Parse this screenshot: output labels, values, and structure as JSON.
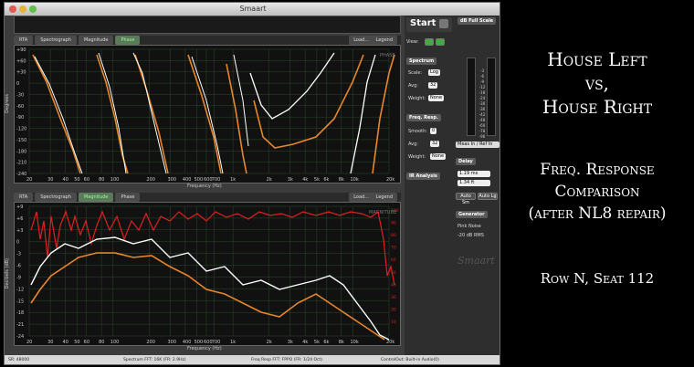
{
  "window": {
    "title": "Smaart",
    "status": {
      "sample_rate": "SR: 48000",
      "spectrum_fft": "Spectrum FFT: 16K (FR: 2.9Hz)",
      "freq_resp_fft": "Freq Resp FFT: FPPO (FR: 1/24 Oct)",
      "control": "ControlOut: Built-in Audio(0)"
    }
  },
  "top_plot": {
    "tabs": [
      "RTA",
      "Spectrograph",
      "Magnitude",
      "Phase"
    ],
    "active_tab": "Phase",
    "load_label": "Load...",
    "legend_label": "Legend",
    "overlay_label": "PHASE",
    "y_axis_label": "Degrees",
    "x_axis_label": "Frequency (Hz)",
    "y_ticks": [
      "+90",
      "+60",
      "+30",
      "0",
      "-30",
      "-60",
      "-90",
      "-120",
      "-150",
      "-180",
      "-210",
      "-240"
    ],
    "x_ticks": [
      "20",
      "30",
      "40",
      "50",
      "60",
      "80",
      "100",
      "200",
      "300",
      "400",
      "500",
      "600",
      "700",
      "1k",
      "2k",
      "3k",
      "4k",
      "5k",
      "6k",
      "8k",
      "10k",
      "20k"
    ]
  },
  "bottom_plot": {
    "tabs": [
      "RTA",
      "Spectrograph",
      "Magnitude",
      "Phase"
    ],
    "active_tab": "Magnitude",
    "load_label": "Load...",
    "legend_label": "Legend",
    "overlay_label": "MAGNITUDE",
    "y_axis_label": "Decibels (dB)",
    "x_axis_label": "Frequency (Hz)",
    "y_ticks": [
      "+9",
      "+6",
      "+3",
      "0",
      "-3",
      "-6",
      "-9",
      "-12",
      "-15",
      "-18",
      "-21",
      "-24"
    ],
    "coherence_ticks": [
      "100",
      "90",
      "80",
      "70",
      "60",
      "50",
      "40",
      "30",
      "20",
      "10"
    ],
    "x_ticks": [
      "20",
      "30",
      "40",
      "50",
      "60",
      "80",
      "100",
      "200",
      "300",
      "400",
      "500",
      "600",
      "700",
      "1k",
      "2k",
      "3k",
      "4k",
      "5k",
      "6k",
      "8k",
      "10k",
      "20k"
    ]
  },
  "right_panel": {
    "start_label": "Start",
    "full_scale_label": "dB Full Scale",
    "view_label": "View:",
    "spectrum_section": "Spectrum",
    "scale_label": "Scale:",
    "scale_value": "Log",
    "avg_label": "Avg:",
    "avg_value": "32",
    "weight_label": "Weight:",
    "weight_value": "None",
    "freq_resp_section": "Freq. Resp.",
    "smooth_label": "Smooth:",
    "smooth_value": "0",
    "fr_avg_label": "Avg:",
    "fr_avg_value": "32",
    "fr_weight_label": "Weight:",
    "fr_weight_value": "None",
    "ir_analysis_label": "IR Analysis",
    "meter_ticks": [
      "-3",
      "-6",
      "-9",
      "-12",
      "-18",
      "-24",
      "-30",
      "-36",
      "-42",
      "-48",
      "-60",
      "-78",
      "-96"
    ],
    "meas_in_label": "Meas In / Ref In",
    "delay_section": "Delay",
    "delay_ms": "1.19 ms",
    "delay_ft": "1.34 ft",
    "auto_sm_label": "Auto Sm",
    "auto_lg_label": "Auto Lg",
    "generator_section": "Generator",
    "gen_signal": "Pink Noise",
    "gen_level": "-20 dB RMS",
    "watermark": "Smaart"
  },
  "annotation": {
    "line1": "House Left",
    "line2": "vs,",
    "line3": "House Right",
    "line4": "Freq. Response",
    "line5": "Comparison",
    "line6": "(after NL8 repair)",
    "line7": "Row N, Seat 112"
  },
  "colors": {
    "trace_orange": "#e8872a",
    "trace_white": "#ffffff",
    "coherence_red": "#e02020",
    "grid": "#2d4a2d"
  }
}
